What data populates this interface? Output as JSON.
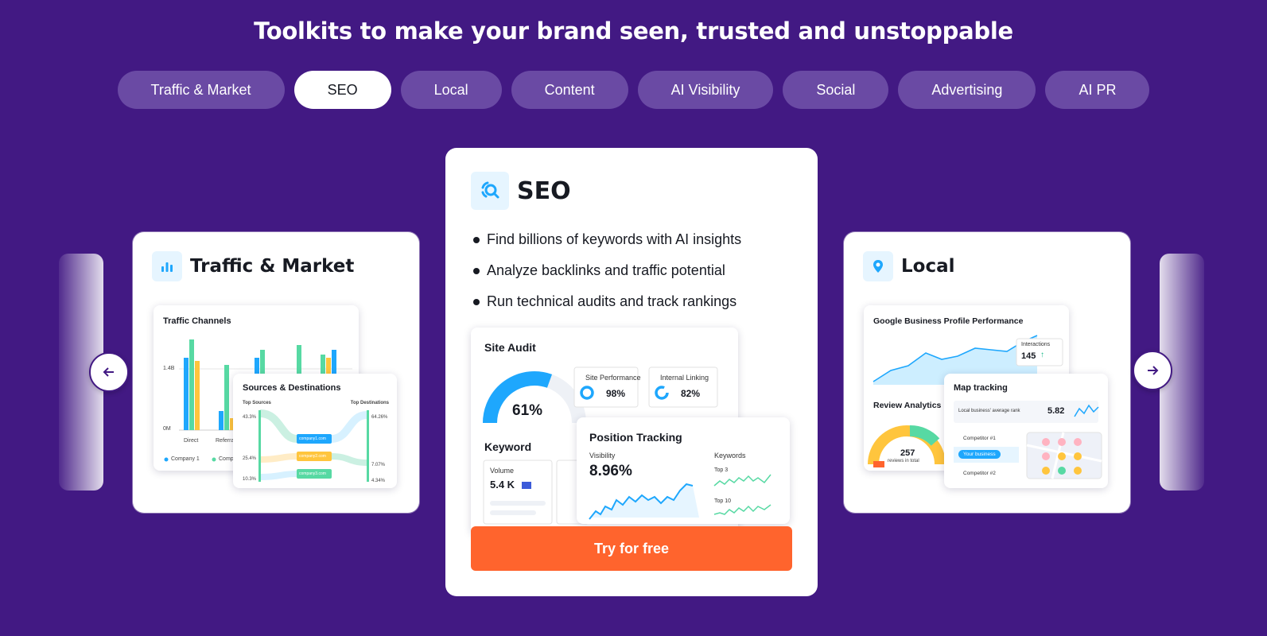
{
  "headline": "Toolkits to make your brand seen, trusted and unstoppable",
  "tabs": [
    {
      "label": "Traffic & Market"
    },
    {
      "label": "SEO"
    },
    {
      "label": "Local"
    },
    {
      "label": "Content"
    },
    {
      "label": "AI Visibility"
    },
    {
      "label": "Social"
    },
    {
      "label": "Advertising"
    },
    {
      "label": "AI PR"
    }
  ],
  "active_tab": "SEO",
  "colors": {
    "background": "#421983",
    "accent": "#ff642d",
    "chart_blue": "#1ea7fd",
    "chart_green": "#57d9a3",
    "chart_yellow": "#ffc53d"
  },
  "traffic": {
    "title": "Traffic & Market",
    "channels": {
      "title": "Traffic Channels",
      "y_ticks": [
        "1.4B",
        "0M"
      ],
      "categories": [
        "Direct",
        "Referra"
      ],
      "legend": [
        "Company 1",
        "Comp"
      ]
    },
    "sources": {
      "title": "Sources & Destinations",
      "top_sources": "Top Sources",
      "top_destinations": "Top Destinations",
      "left_values": [
        "43.3%",
        "25.4%",
        "10.3%"
      ],
      "right_values": [
        "64.26%",
        "7.07%",
        "4.34%"
      ],
      "nodes": [
        "company1.com",
        "company2.com",
        "company3.com"
      ]
    }
  },
  "seo": {
    "title": "SEO",
    "bullets": [
      "Find billions of keywords with AI insights",
      "Analyze backlinks and traffic potential",
      "Run technical audits and track rankings"
    ],
    "site_audit": {
      "title": "Site Audit",
      "score": "61%",
      "score_value": 0.61,
      "performance_label": "Site Performance",
      "performance_value": "98%",
      "linking_label": "Internal Linking",
      "linking_value": "82%"
    },
    "keyword": {
      "title": "Keyword",
      "volume_label": "Volume",
      "volume_value": "5.4 K"
    },
    "position": {
      "title": "Position Tracking",
      "visibility_label": "Visibility",
      "visibility_value": "8.96%",
      "keywords_label": "Keywords",
      "top3": "Top 3",
      "top10": "Top 10"
    },
    "cta": "Try for free"
  },
  "local": {
    "title": "Local",
    "gbp": {
      "title": "Google Business Profile Performance",
      "interactions_label": "Interactions",
      "interactions_value": "145"
    },
    "review": {
      "title": "Review Analytics",
      "count": "257",
      "count_label": "reviews in total"
    },
    "map": {
      "title": "Map tracking",
      "rank_label": "Local business' average rank",
      "rank_value": "5.82",
      "competitor1": "Competitor #1",
      "your_business": "Your business",
      "competitor2": "Competitor #2"
    }
  }
}
